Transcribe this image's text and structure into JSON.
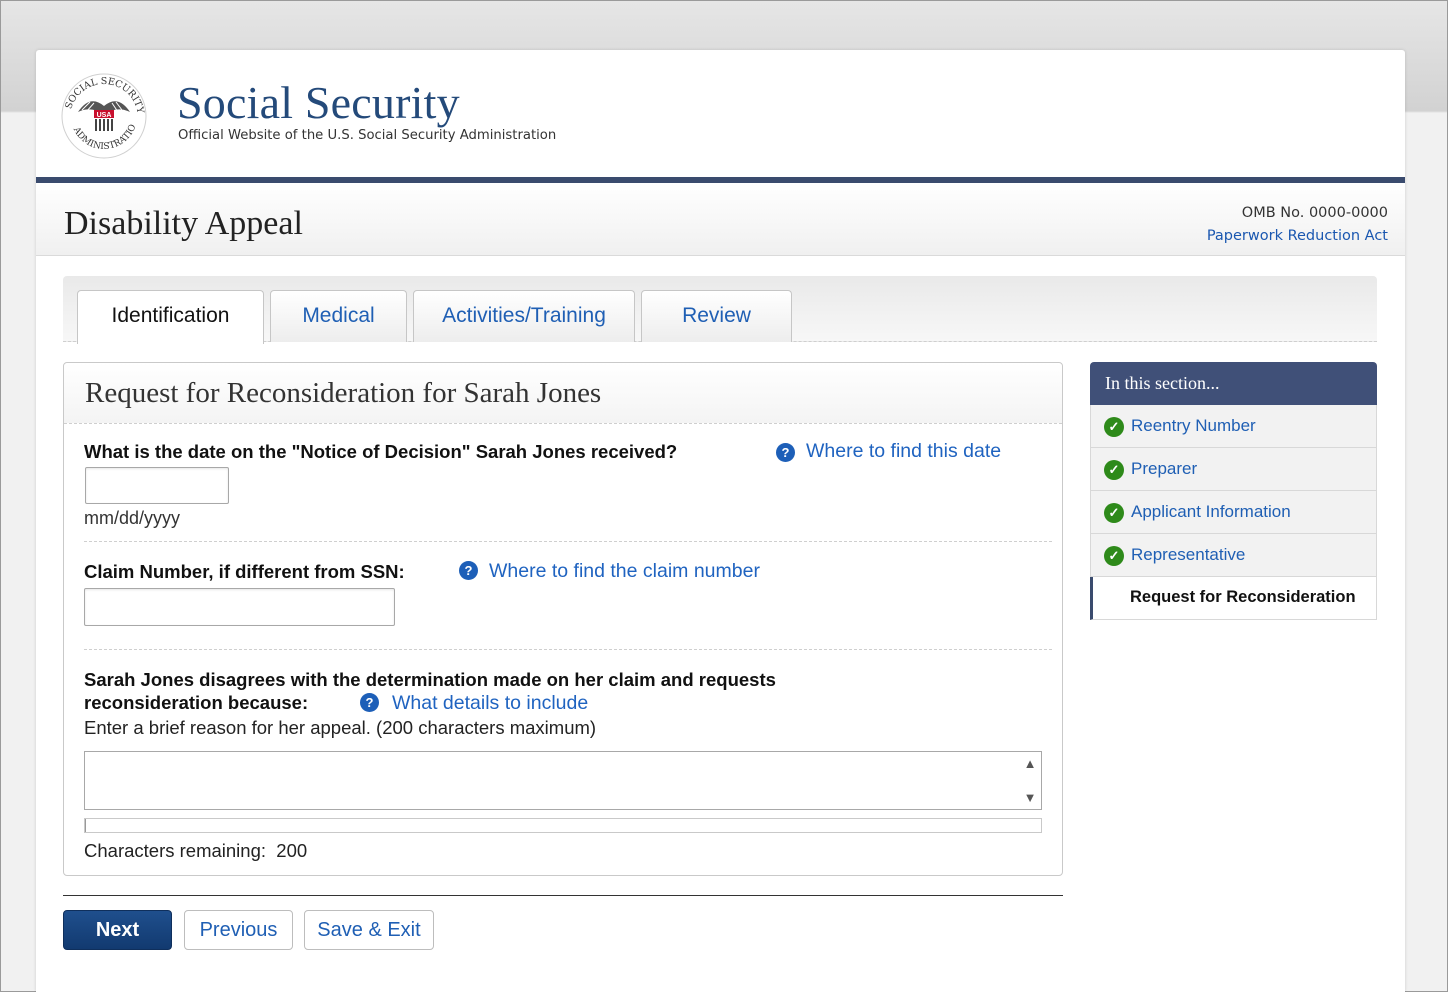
{
  "header": {
    "site_title": "Social Security",
    "site_subtitle": "Official Website of the U.S. Social Security Administration",
    "seal_text": "SOCIAL SECURITY ADMINISTRATION",
    "seal_flag_text": "USA"
  },
  "titlebar": {
    "title": "Disability Appeal",
    "omb": "OMB No. 0000-0000",
    "paperwork_link": "Paperwork Reduction Act"
  },
  "tabs": [
    {
      "label": "Identification",
      "active": true
    },
    {
      "label": "Medical",
      "active": false
    },
    {
      "label": "Activities/Training",
      "active": false
    },
    {
      "label": "Review",
      "active": false
    }
  ],
  "form": {
    "title": "Request for Reconsideration for Sarah Jones",
    "q1": {
      "label": "What is the date on the \"Notice of Decision\" Sarah Jones received?",
      "help_link": "Where to find this date",
      "value": "",
      "hint": "mm/dd/yyyy"
    },
    "q2": {
      "label": "Claim Number, if different from SSN:",
      "help_link": "Where to find the claim number",
      "value": ""
    },
    "q3": {
      "label_line1": "Sarah Jones disagrees with the determination made on her claim and requests",
      "label_line2": "reconsideration because:",
      "help_link": "What details to include",
      "instruction": "Enter a brief reason for her appeal. (200 characters maximum)",
      "value": "",
      "chars_remaining_label": "Characters remaining:",
      "chars_remaining": "200"
    },
    "help_icon_glyph": "?"
  },
  "buttons": {
    "next": "Next",
    "previous": "Previous",
    "save_exit": "Save & Exit"
  },
  "sidenav": {
    "heading": "In this section...",
    "items": [
      {
        "label": "Reentry Number",
        "status": "complete",
        "icon": "check-circle-icon"
      },
      {
        "label": "Preparer",
        "status": "complete",
        "icon": "check-circle-icon"
      },
      {
        "label": "Applicant Information",
        "status": "complete",
        "icon": "check-circle-icon"
      },
      {
        "label": "Representative",
        "status": "complete",
        "icon": "check-circle-icon"
      },
      {
        "label": "Request for Reconsideration",
        "status": "current"
      }
    ]
  },
  "colors": {
    "brand_navy": "#3a4b6e",
    "link_blue": "#1f5fb4",
    "check_green": "#2e8a1a",
    "primary_button": "#1a4580"
  }
}
